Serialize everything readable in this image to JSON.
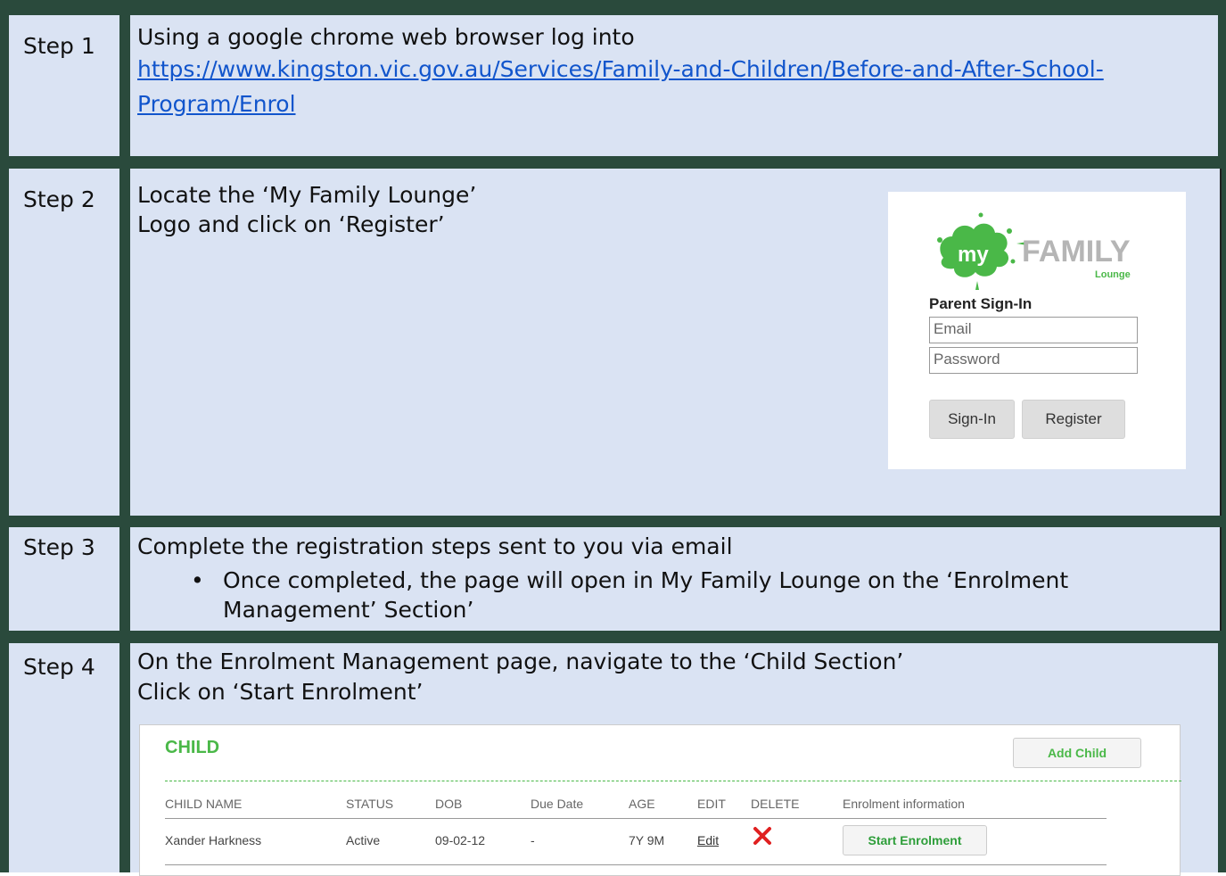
{
  "steps": [
    {
      "label": "Step 1",
      "line1": "Using  a google chrome web browser log into",
      "link_line1": "https://www.kingston.vic.gov.au/Services/Family-and-Children/Before-and-After-School-",
      "link_line2": "Program/Enrol"
    },
    {
      "label": "Step 2",
      "line1": "Locate the ‘My Family Lounge’",
      "line2": "Logo and click on ‘Register’"
    },
    {
      "label": "Step 3",
      "line1": "Complete the registration steps sent to you via email",
      "bullet_line1": "Once completed, the page will open in My Family Lounge on the ‘Enrolment",
      "bullet_line2": "Management’ Section’"
    },
    {
      "label": "Step 4",
      "line1": "On the Enrolment Management page, navigate to the ‘Child Section’",
      "line2": "Click on ‘Start Enrolment’"
    }
  ],
  "login_widget": {
    "logo_my": "my",
    "logo_family": "FAMILY",
    "logo_lounge": "Lounge",
    "title": "Parent Sign-In",
    "email_placeholder": "Email",
    "password_placeholder": "Password",
    "signin_label": "Sign-In",
    "register_label": "Register",
    "brand_green": "#4ab848"
  },
  "child_panel": {
    "title": "CHILD",
    "add_child_label": "Add Child",
    "headers": [
      "CHILD NAME",
      "STATUS",
      "DOB",
      "Due Date",
      "AGE",
      "EDIT",
      "DELETE",
      "Enrolment information"
    ],
    "row": {
      "name": "Xander Harkness",
      "status": "Active",
      "dob": "09-02-12",
      "due_date": "-",
      "age": "7Y 9M",
      "edit": "Edit",
      "start_label": "Start Enrolment"
    },
    "delete_icon": "red-x-icon"
  },
  "colors": {
    "border_dark_green": "#2a4a3c",
    "cell_blue": "#dae3f3",
    "link_blue": "#1155cc",
    "delete_red": "#e02020"
  }
}
